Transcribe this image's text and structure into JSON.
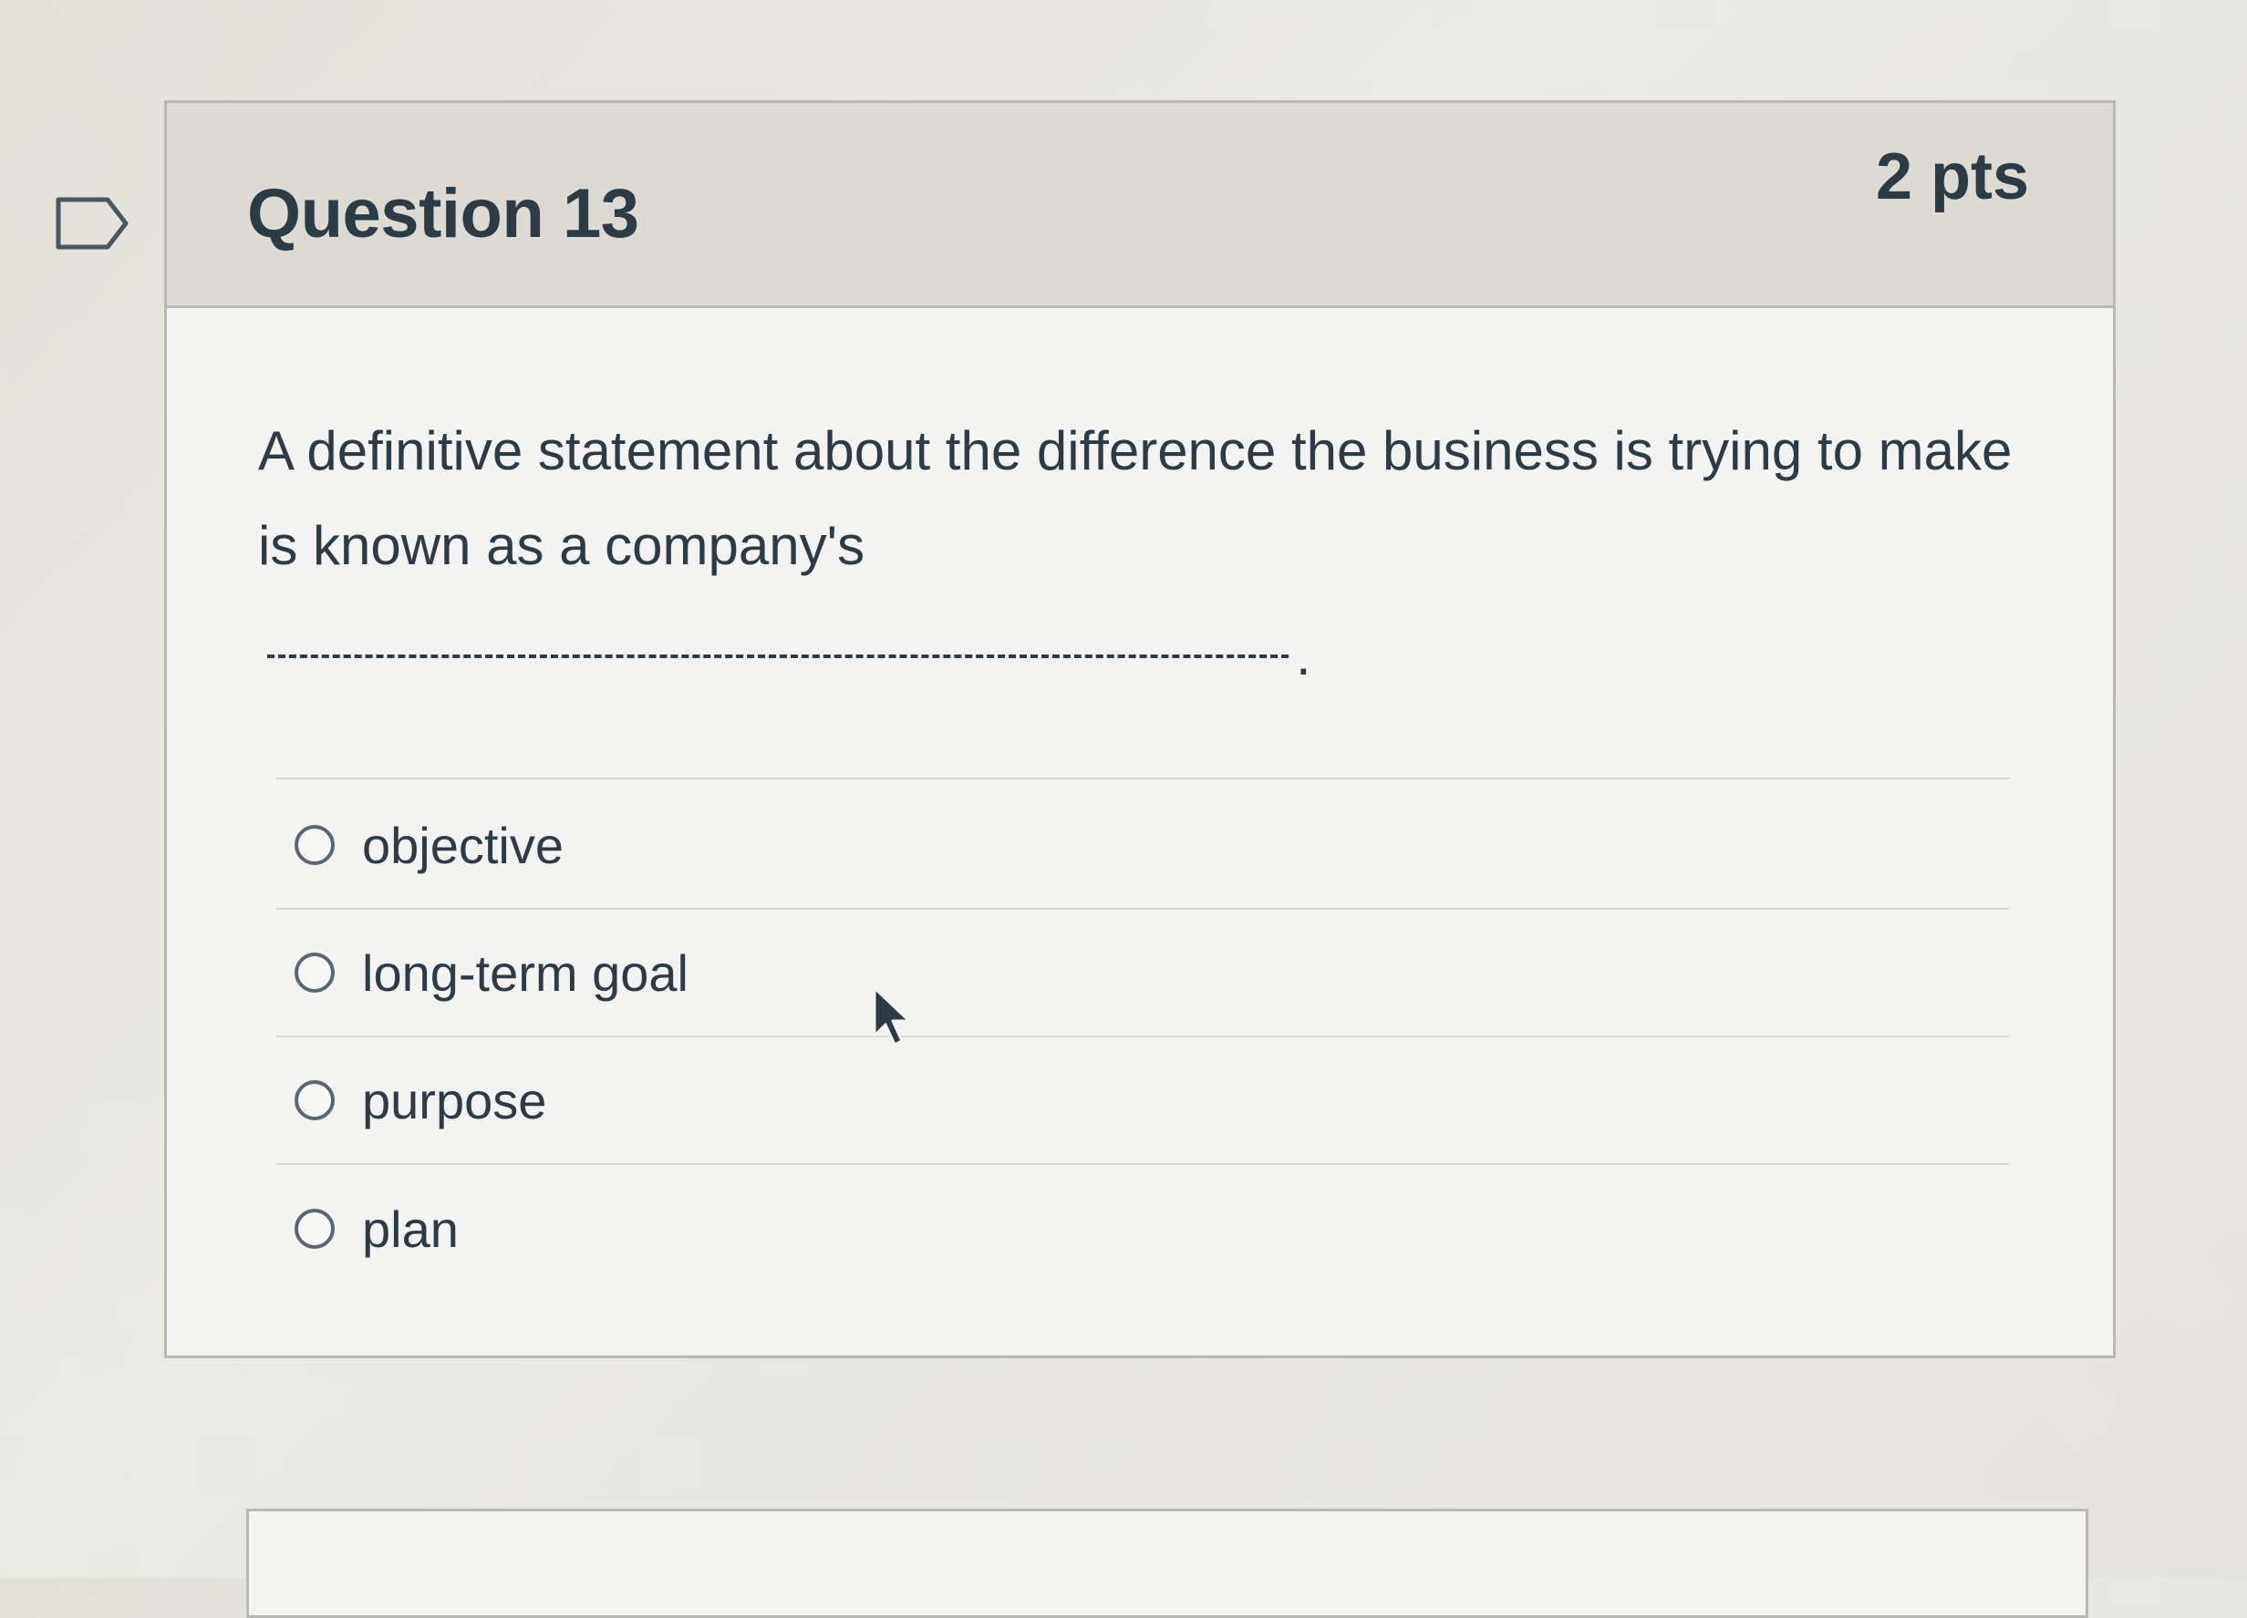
{
  "question": {
    "title": "Question 13",
    "points": "2 pts",
    "text": "A definitive statement about the difference the business is trying to make is known as a company's",
    "blank_period": "."
  },
  "answers": [
    {
      "label": "objective",
      "selected": false
    },
    {
      "label": "long-term goal",
      "selected": false
    },
    {
      "label": "purpose",
      "selected": false
    },
    {
      "label": "plan",
      "selected": false
    }
  ],
  "icons": {
    "flag": "flag-icon",
    "cursor": "mouse-cursor-icon"
  },
  "colors": {
    "text": "#2d3b45",
    "header_bg": "#dcdad2",
    "card_bg": "#f3f3f1",
    "border": "#b8b8b2"
  }
}
